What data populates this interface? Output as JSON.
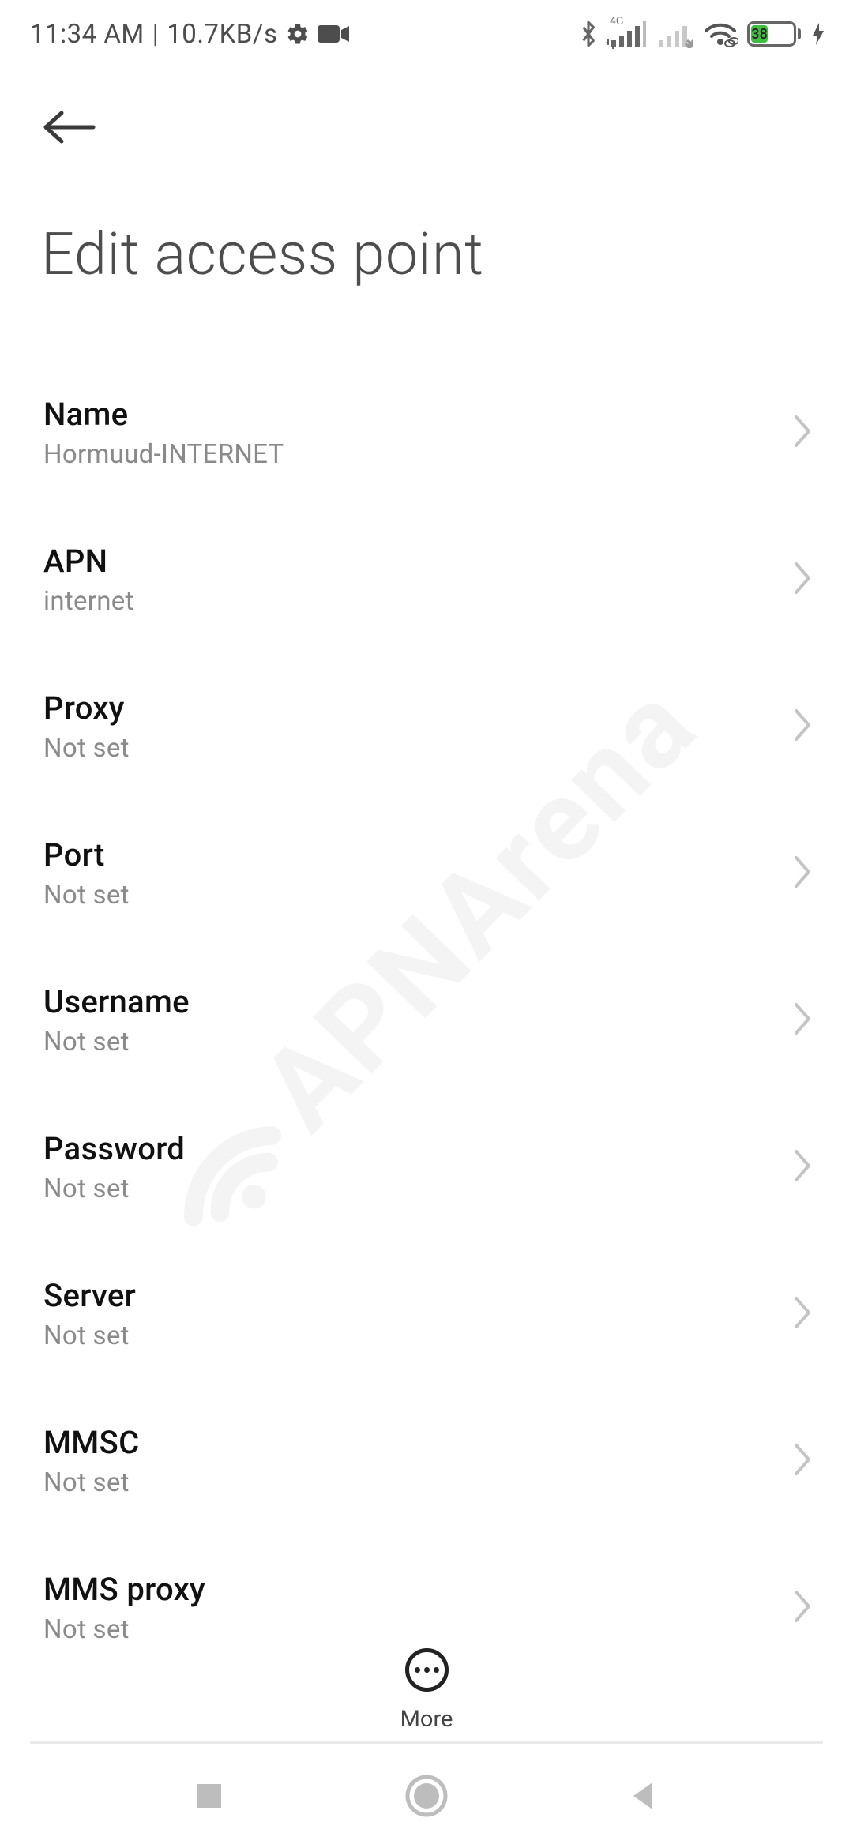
{
  "status": {
    "time": "11:34 AM",
    "separator": "|",
    "net_speed": "10.7KB/s",
    "sim1_type": "4G",
    "battery_pct": "38"
  },
  "header": {
    "title": "Edit access point"
  },
  "rows": [
    {
      "label": "Name",
      "value": "Hormuud-INTERNET"
    },
    {
      "label": "APN",
      "value": "internet"
    },
    {
      "label": "Proxy",
      "value": "Not set"
    },
    {
      "label": "Port",
      "value": "Not set"
    },
    {
      "label": "Username",
      "value": "Not set"
    },
    {
      "label": "Password",
      "value": "Not set"
    },
    {
      "label": "Server",
      "value": "Not set"
    },
    {
      "label": "MMSC",
      "value": "Not set"
    },
    {
      "label": "MMS proxy",
      "value": "Not set"
    }
  ],
  "bottom": {
    "more_label": "More"
  },
  "watermark": {
    "text": "APNArena"
  },
  "colors": {
    "battery_fill": "#3fbf3f",
    "text_primary": "#111111",
    "text_secondary": "#8a8a8a",
    "title": "#4d4d4d",
    "divider": "#eaeaea"
  }
}
